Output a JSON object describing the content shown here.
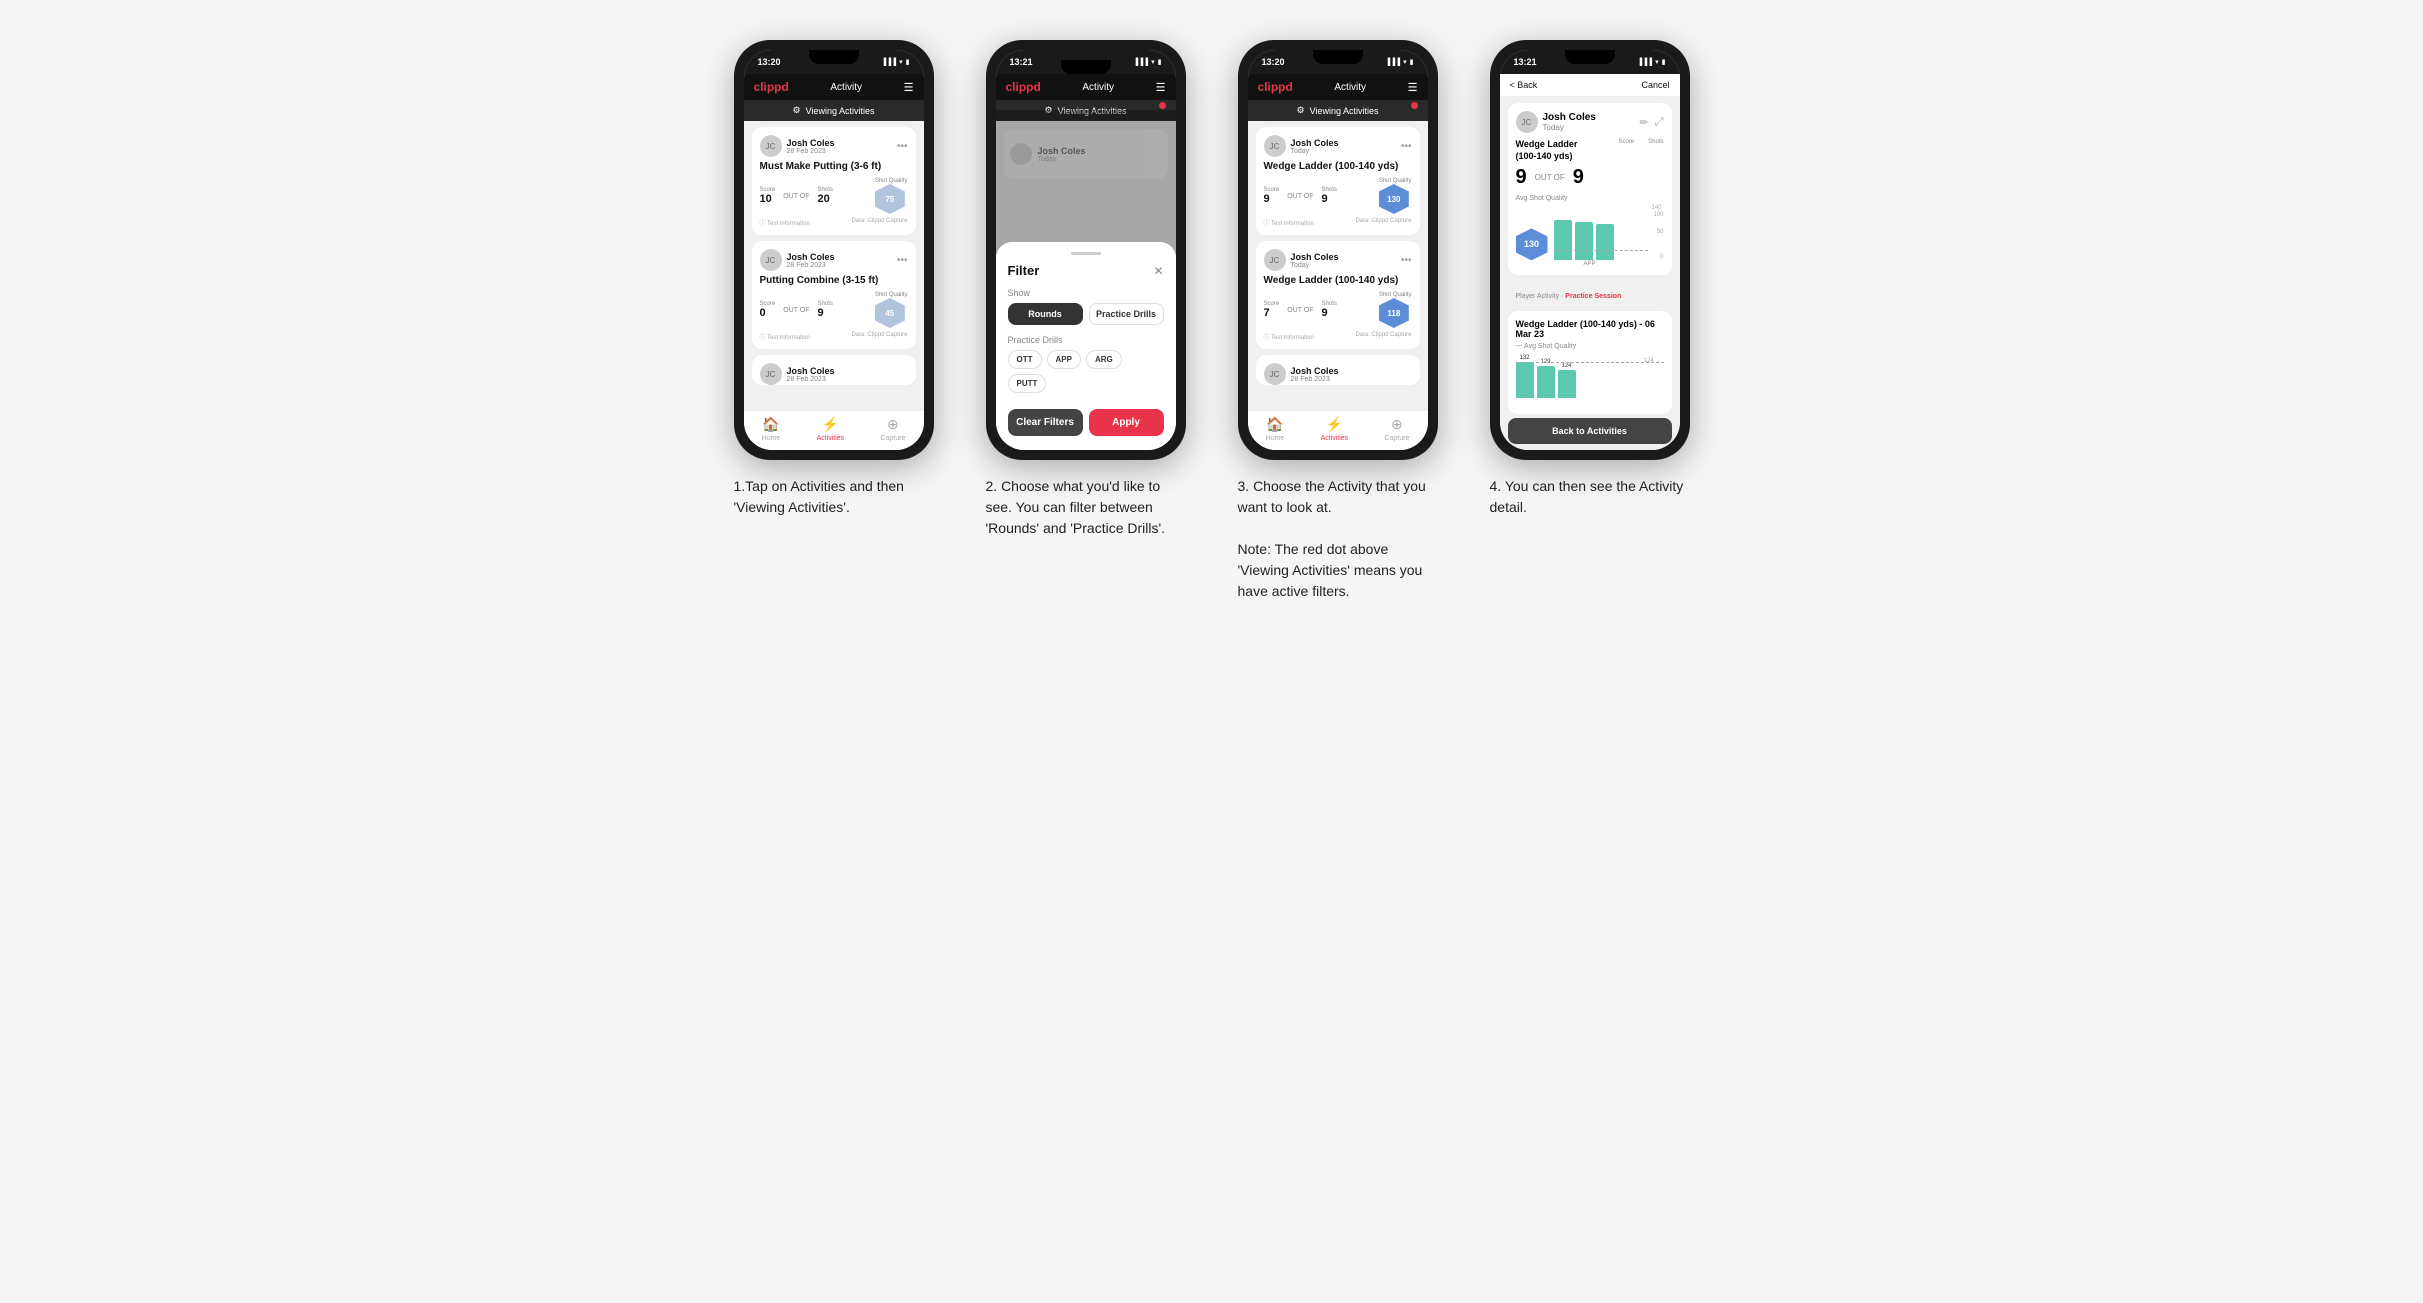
{
  "phones": [
    {
      "id": "phone1",
      "status_time": "13:20",
      "header": {
        "logo": "clippd",
        "title": "Activity",
        "menu": "☰"
      },
      "viewing_bar": "Viewing Activities",
      "has_red_dot": false,
      "cards": [
        {
          "name": "Josh Coles",
          "date": "28 Feb 2023",
          "title": "Must Make Putting (3-6 ft)",
          "score_label": "Score",
          "shots_label": "Shots",
          "quality_label": "Shot Quality",
          "score": "10",
          "out_of": "OUT OF",
          "shots": "20",
          "quality": "75"
        },
        {
          "name": "Josh Coles",
          "date": "28 Feb 2023",
          "title": "Putting Combine (3-15 ft)",
          "score_label": "Score",
          "shots_label": "Shots",
          "quality_label": "Shot Quality",
          "score": "0",
          "out_of": "OUT OF",
          "shots": "9",
          "quality": "45"
        },
        {
          "name": "Josh Coles",
          "date": "28 Feb 2023",
          "title": ""
        }
      ],
      "nav": [
        {
          "icon": "🏠",
          "label": "Home",
          "active": false
        },
        {
          "icon": "⚡",
          "label": "Activities",
          "active": true
        },
        {
          "icon": "⊕",
          "label": "Capture",
          "active": false
        }
      ],
      "footer_info": "Test Information",
      "footer_data": "Data: Clippd Capture"
    },
    {
      "id": "phone2",
      "status_time": "13:21",
      "header": {
        "logo": "clippd",
        "title": "Activity",
        "menu": "☰"
      },
      "viewing_bar": "Viewing Activities",
      "has_red_dot": true,
      "filter": {
        "title": "Filter",
        "show_label": "Show",
        "rounds_btn": "Rounds",
        "practice_btn": "Practice Drills",
        "practice_drills_label": "Practice Drills",
        "chips": [
          "OTT",
          "APP",
          "ARG",
          "PUTT"
        ],
        "clear_label": "Clear Filters",
        "apply_label": "Apply"
      }
    },
    {
      "id": "phone3",
      "status_time": "13:20",
      "header": {
        "logo": "clippd",
        "title": "Activity",
        "menu": "☰"
      },
      "viewing_bar": "Viewing Activities",
      "has_red_dot": true,
      "cards": [
        {
          "name": "Josh Coles",
          "date": "Today",
          "title": "Wedge Ladder (100-140 yds)",
          "score": "9",
          "out_of": "OUT OF",
          "shots": "9",
          "quality": "130",
          "quality_color": "blue"
        },
        {
          "name": "Josh Coles",
          "date": "Today",
          "title": "Wedge Ladder (100-140 yds)",
          "score": "7",
          "out_of": "OUT OF",
          "shots": "9",
          "quality": "118",
          "quality_color": "blue"
        },
        {
          "name": "Josh Coles",
          "date": "28 Feb 2023",
          "title": ""
        }
      ],
      "nav": [
        {
          "icon": "🏠",
          "label": "Home",
          "active": false
        },
        {
          "icon": "⚡",
          "label": "Activities",
          "active": true
        },
        {
          "icon": "⊕",
          "label": "Capture",
          "active": false
        }
      ]
    },
    {
      "id": "phone4",
      "status_time": "13:21",
      "back_label": "< Back",
      "cancel_label": "Cancel",
      "detail": {
        "name": "Josh Coles",
        "date": "Today",
        "drill_title": "Wedge Ladder\n(100-140 yds)",
        "score_label": "Score",
        "shots_label": "Shots",
        "score": "9",
        "out_of": "OUT OF",
        "shots": "9",
        "avg_label": "Avg Shot Quality",
        "hex_value": "130",
        "chart_values": [
          132,
          129,
          124
        ],
        "chart_max": 140,
        "y_labels": [
          "140",
          "100",
          "50",
          "0"
        ],
        "app_label": "APP",
        "practice_session_label": "Player Activity",
        "practice_session_link": "Practice Session",
        "secondary_title": "Wedge Ladder (100-140 yds) - 06 Mar 23",
        "secondary_subtitle": "--- Avg Shot Quality",
        "bar_values": [
          132,
          129,
          124
        ],
        "back_btn": "Back to Activities"
      }
    }
  ],
  "captions": [
    "1.Tap on Activities and\nthen 'Viewing Activities'.",
    "2. Choose what you'd\nlike to see. You can\nfilter between 'Rounds'\nand 'Practice Drills'.",
    "3. Choose the Activity\nthat you want to look at.\n\nNote: The red dot above\n'Viewing Activities' means\nyou have active filters.",
    "4. You can then\nsee the Activity\ndetail."
  ]
}
